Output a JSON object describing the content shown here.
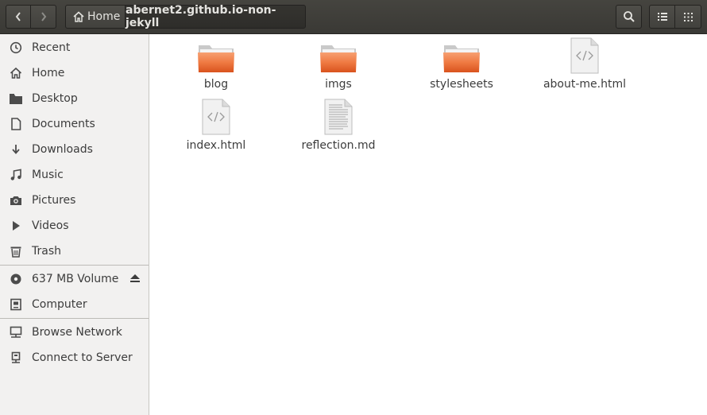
{
  "toolbar": {
    "back_icon": "chevron-left-icon",
    "forward_icon": "chevron-right-icon",
    "path_home_label": "Home",
    "path_current_label": "abernet2.github.io-non-jekyll",
    "search_icon": "search-icon",
    "list_view_icon": "list-view-icon",
    "grid_view_icon": "grid-view-icon"
  },
  "sidebar": {
    "items": [
      {
        "label": "Recent",
        "icon": "clock-icon"
      },
      {
        "label": "Home",
        "icon": "home-icon"
      },
      {
        "label": "Desktop",
        "icon": "folder-icon"
      },
      {
        "label": "Documents",
        "icon": "document-icon"
      },
      {
        "label": "Downloads",
        "icon": "download-icon"
      },
      {
        "label": "Music",
        "icon": "music-icon"
      },
      {
        "label": "Pictures",
        "icon": "camera-icon"
      },
      {
        "label": "Videos",
        "icon": "video-icon"
      },
      {
        "label": "Trash",
        "icon": "trash-icon"
      }
    ],
    "devices": [
      {
        "label": "637 MB Volume",
        "icon": "disk-icon"
      },
      {
        "label": "Computer",
        "icon": "computer-icon"
      }
    ],
    "network": [
      {
        "label": "Browse Network",
        "icon": "network-icon"
      },
      {
        "label": "Connect to Server",
        "icon": "server-icon"
      }
    ]
  },
  "files": [
    {
      "name": "blog",
      "type": "folder"
    },
    {
      "name": "imgs",
      "type": "folder"
    },
    {
      "name": "stylesheets",
      "type": "folder"
    },
    {
      "name": "about-me.html",
      "type": "html"
    },
    {
      "name": "index.html",
      "type": "html"
    },
    {
      "name": "reflection.md",
      "type": "text"
    }
  ],
  "colors": {
    "headerbar": "#3c3b37",
    "sidebar": "#f2f1f0",
    "folder_orange": "#e9672f",
    "text": "#3c3c3c"
  }
}
